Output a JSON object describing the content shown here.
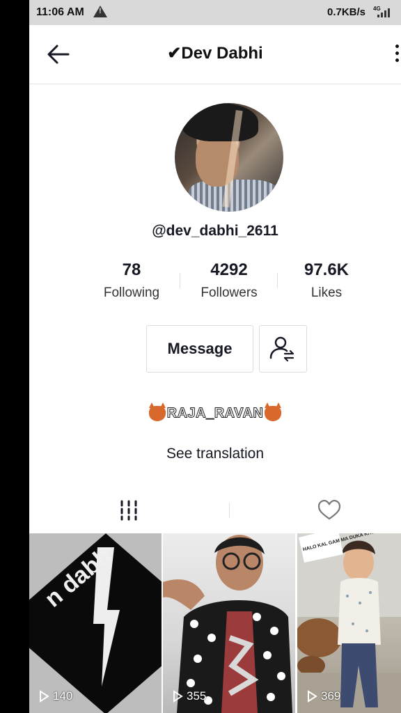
{
  "status_bar": {
    "time": "11:06 AM",
    "net_speed": "0.7KB/s",
    "network": "4G"
  },
  "header": {
    "title": "✔Dev Dabhi"
  },
  "profile": {
    "username": "@dev_dabhi_2611",
    "stats": [
      {
        "value": "78",
        "label": "Following"
      },
      {
        "value": "4292",
        "label": "Followers"
      },
      {
        "value": "97.6K",
        "label": "Likes"
      }
    ],
    "message_label": "Message",
    "bio": "RAJA_RAVAN",
    "see_translation": "See translation"
  },
  "videos": [
    {
      "views": "140",
      "overlay_text": "n dabh"
    },
    {
      "views": "355"
    },
    {
      "views": "369",
      "overlay_text": "HALO KAL GAM MA DUKA KHULVANI"
    }
  ],
  "colors": {
    "background": "#ffffff",
    "status_bar": "#d9d9d9",
    "text": "#161823",
    "border": "#dcdcdc"
  },
  "icons": [
    "back-arrow-icon",
    "warning-icon",
    "signal-icon",
    "more-icon",
    "follow-suggest-icon",
    "devil-emoji-icon",
    "grid-videos-icon",
    "heart-icon",
    "play-icon"
  ]
}
